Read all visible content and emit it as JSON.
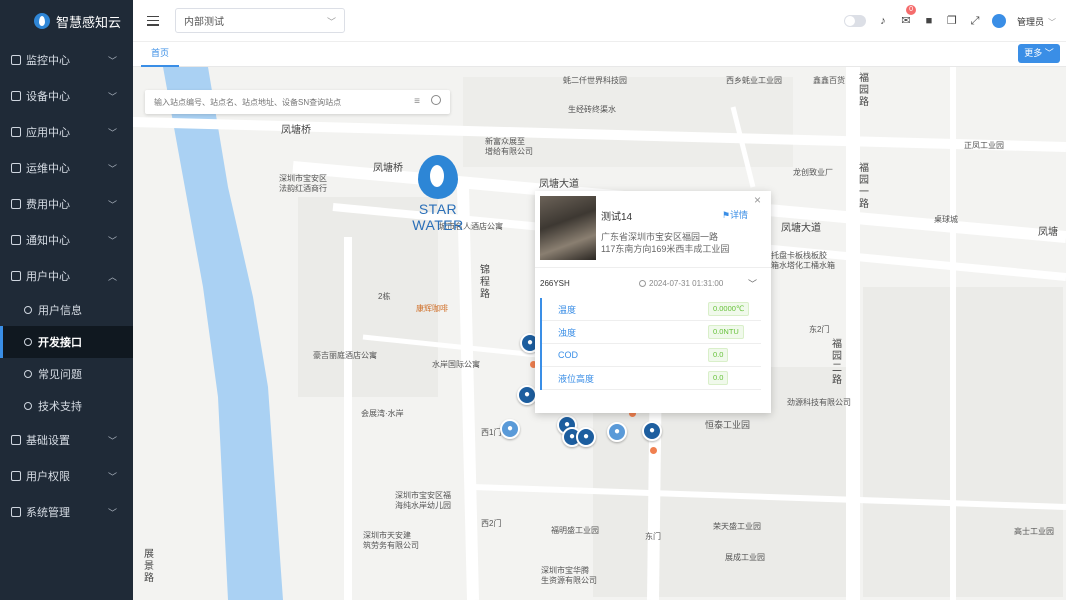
{
  "app": {
    "title": "智慧感知云"
  },
  "sidebar": {
    "items": [
      {
        "label": "监控中心",
        "icon": "monitor-icon"
      },
      {
        "label": "设备中心",
        "icon": "device-icon"
      },
      {
        "label": "应用中心",
        "icon": "apps-icon"
      },
      {
        "label": "运维中心",
        "icon": "ops-icon"
      },
      {
        "label": "费用中心",
        "icon": "billing-icon"
      },
      {
        "label": "通知中心",
        "icon": "bell-icon"
      },
      {
        "label": "用户中心",
        "icon": "user-icon",
        "expanded": true
      }
    ],
    "sub_items": [
      {
        "label": "用户信息",
        "icon": "user-info-icon"
      },
      {
        "label": "开发接口",
        "icon": "api-icon",
        "active": true
      },
      {
        "label": "常见问题",
        "icon": "faq-icon"
      },
      {
        "label": "技术支持",
        "icon": "support-icon"
      }
    ],
    "items_after": [
      {
        "label": "基础设置",
        "icon": "settings-icon"
      },
      {
        "label": "用户权限",
        "icon": "permission-icon"
      },
      {
        "label": "系统管理",
        "icon": "system-icon"
      }
    ]
  },
  "header": {
    "org_select": "内部测试",
    "notification_count": "0",
    "user_name": "管理员"
  },
  "tabs": {
    "home": "首页",
    "more": "更多"
  },
  "map": {
    "search_placeholder": "输入站点编号、站点名、站点地址、设备SN查询站点",
    "brand": "STAR WATER",
    "labels": [
      "蚝二仟世界科技园",
      "生经砖终渠水",
      "新富众展至\n增给有限公司",
      "凤塘桥",
      "凤塘桥",
      "深圳市宝安区\n法韵红酒商行",
      "凤塘大道",
      "城市名人酒店公寓",
      "2栋",
      "康辉咖啡",
      "豪吉丽庭酒店公寓",
      "水岸国际公寓",
      "会展湾·水岸",
      "深圳市宝安区福\n海纯水岸幼儿园",
      "深圳市天安建\n筑劳务有限公司",
      "福明盛工业园",
      "荣天盛工业园",
      "展成工业园",
      "高士工业园",
      "正凤工业园",
      "西乡蚝业工业园",
      "鑫鑫百货",
      "龙创致业厂",
      "托盘卡板栈板胶\n箱水塔化工桶水箱",
      "东2门",
      "劲源科技有限公司",
      "恒泰工业园",
      "深圳市宝华腾\n生资源有限公司",
      "西1门",
      "西2门",
      "东门",
      "桌球城",
      "凤塘大道",
      "凤塘"
    ],
    "roads_vertical": [
      "锦程路",
      "福园一路",
      "福园二路",
      "展景路",
      "福园路"
    ]
  },
  "popup": {
    "title": "测试14",
    "detail_link": "详情",
    "address": "广东省深圳市宝安区福园一路117东南方向169米西丰成工业园",
    "device_sn": "266YSH",
    "timestamp": "2024-07-31 01:31:00",
    "metrics": [
      {
        "label": "温度",
        "value": "0.0000℃"
      },
      {
        "label": "浊度",
        "value": "0.0NTU"
      },
      {
        "label": "COD",
        "value": "0.0"
      },
      {
        "label": "液位高度",
        "value": "0.0"
      }
    ]
  },
  "colors": {
    "accent": "#3a8ee6",
    "sidebar_bg": "#1f2a37",
    "river": "#aad1f3",
    "ok_green": "#67c23a"
  }
}
